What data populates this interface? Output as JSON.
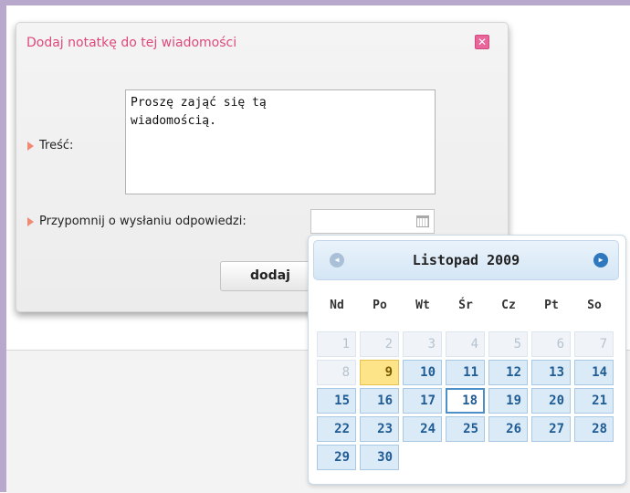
{
  "dialog": {
    "title": "Dodaj notatkę do tej wiadomości",
    "close_symbol": "✕",
    "content_label": "Treść:",
    "content_value": "Proszę zająć się tą\nwiadomością.",
    "reminder_label": "Przypomnij o wysłaniu odpowiedzi:",
    "reminder_value": "",
    "submit_label": "dodaj"
  },
  "calendar": {
    "title": "Listopad 2009",
    "prev_icon": "chevron-left-icon",
    "next_icon": "chevron-right-icon",
    "weekdays": [
      "Nd",
      "Po",
      "Wt",
      "Śr",
      "Cz",
      "Pt",
      "So"
    ],
    "rows": [
      [
        "1",
        "2",
        "3",
        "4",
        "5",
        "6",
        "7"
      ],
      [
        "8",
        "9",
        "10",
        "11",
        "12",
        "13",
        "14"
      ],
      [
        "15",
        "16",
        "17",
        "18",
        "19",
        "20",
        "21"
      ],
      [
        "22",
        "23",
        "24",
        "25",
        "26",
        "27",
        "28"
      ],
      [
        "29",
        "30"
      ]
    ],
    "disabled_days": [
      "1",
      "2",
      "3",
      "4",
      "5",
      "6",
      "7",
      "8"
    ],
    "today": "9",
    "selected": "18"
  },
  "colors": {
    "title": "#e0487c",
    "arrow": "#f08a72",
    "day_bg": "#dbeaf7",
    "today_bg": "#fde488",
    "selected_border": "#4d8fc8"
  }
}
